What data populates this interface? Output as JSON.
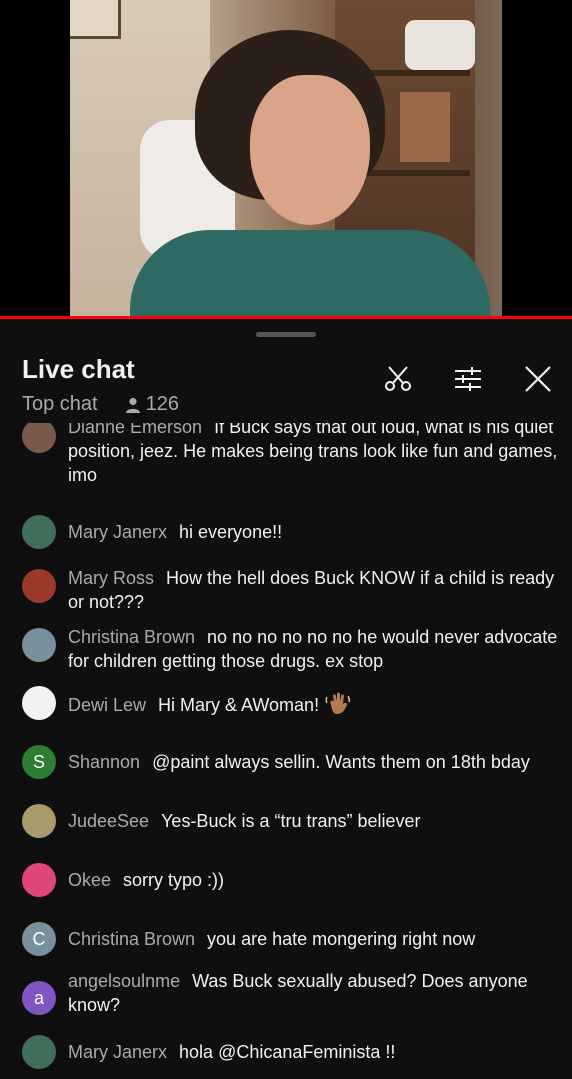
{
  "header": {
    "title": "Live chat",
    "mode": "Top chat",
    "viewer_count": "126"
  },
  "colors": {
    "accent": "#ff0000",
    "background": "#0f0f0f",
    "author": "#aaaaaa",
    "text": "#f1f1f1"
  },
  "icons": {
    "clip": "scissors-icon",
    "filters": "sliders-icon",
    "close": "close-icon",
    "viewers": "person-icon"
  },
  "messages": [
    {
      "author": "Dianne Emerson",
      "text": "If Buck says that out loud, what is his quiet position, jeez. He makes being trans look like fun and games, imo",
      "avatar_initial": "",
      "avatar_color": "#7a5a4a"
    },
    {
      "author": "Mary Janerx",
      "text": "hi everyone!!",
      "avatar_initial": "",
      "avatar_color": "#3f6f5a"
    },
    {
      "author": "Mary Ross",
      "text": "How the hell does Buck KNOW if a child is ready or not???",
      "avatar_initial": "",
      "avatar_color": "#9b3a2a"
    },
    {
      "author": "Christina Brown",
      "text": "no no no no no no he would never advocate for children getting those drugs. ex stop",
      "avatar_initial": "C",
      "avatar_color": "#78909c"
    },
    {
      "author": "Dewi Lew",
      "text": "Hi Mary & AWoman!",
      "avatar_initial": "",
      "avatar_color": "#f2f2f2"
    },
    {
      "author": "Shannon",
      "text": "@paint always sellin. Wants them on 18th bday",
      "avatar_initial": "S",
      "avatar_color": "#2e7d32"
    },
    {
      "author": "JudeeSee",
      "text": "Yes-Buck is a “tru trans” believer",
      "avatar_initial": "",
      "avatar_color": "#a89a6a"
    },
    {
      "author": "Okee",
      "text": "sorry typo :))",
      "avatar_initial": "",
      "avatar_color": "#e0457b"
    },
    {
      "author": "Christina Brown",
      "text": "you are hate mongering right now",
      "avatar_initial": "C",
      "avatar_color": "#78909c"
    },
    {
      "author": "angelsoulnme",
      "text": "Was Buck sexually abused? Does anyone know?",
      "avatar_initial": "a",
      "avatar_color": "#7e57c2"
    },
    {
      "author": "Mary Janerx",
      "text": "hola @ChicanaFeminista !!",
      "avatar_initial": "",
      "avatar_color": "#3f6f5a"
    }
  ]
}
